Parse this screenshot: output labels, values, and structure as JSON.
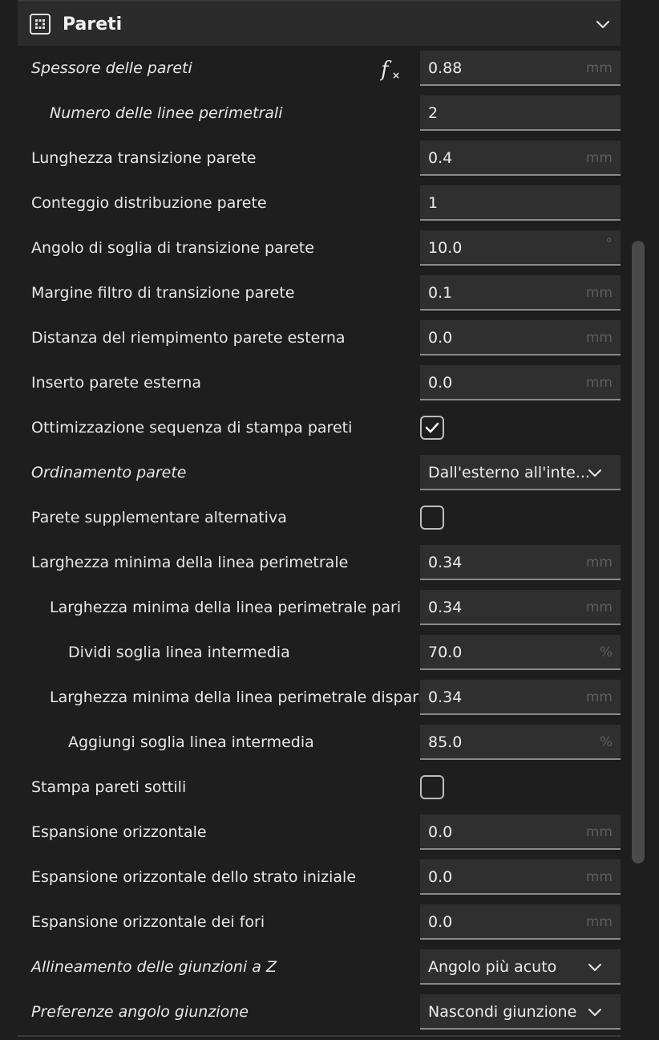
{
  "section": {
    "title": "Pareti",
    "icon": "walls-grid-icon",
    "expand_icon": "chevron-down-icon"
  },
  "rows": [
    {
      "id": "wall-thickness",
      "label": "Spessore delle pareti",
      "italic": true,
      "indent": 0,
      "type": "input",
      "value": "0.88",
      "unit": "mm",
      "formula_icon": true
    },
    {
      "id": "wall-line-count",
      "label": "Numero delle linee perimetrali",
      "italic": true,
      "indent": 1,
      "type": "input",
      "value": "2",
      "unit": ""
    },
    {
      "id": "wall-transition-length",
      "label": "Lunghezza transizione parete",
      "italic": false,
      "indent": 0,
      "type": "input",
      "value": "0.4",
      "unit": "mm"
    },
    {
      "id": "wall-distribution-count",
      "label": "Conteggio distribuzione parete",
      "italic": false,
      "indent": 0,
      "type": "input",
      "value": "1",
      "unit": ""
    },
    {
      "id": "wall-transition-angle",
      "label": "Angolo di soglia di transizione parete",
      "italic": false,
      "indent": 0,
      "type": "input",
      "value": "10.0",
      "unit": "°"
    },
    {
      "id": "wall-transition-filter",
      "label": "Margine filtro di transizione parete",
      "italic": false,
      "indent": 0,
      "type": "input",
      "value": "0.1",
      "unit": "mm"
    },
    {
      "id": "outer-wall-wipe",
      "label": "Distanza del riempimento parete esterna",
      "italic": false,
      "indent": 0,
      "type": "input",
      "value": "0.0",
      "unit": "mm"
    },
    {
      "id": "outer-wall-inset",
      "label": "Inserto parete esterna",
      "italic": false,
      "indent": 0,
      "type": "input",
      "value": "0.0",
      "unit": "mm"
    },
    {
      "id": "optimize-wall-order",
      "label": "Ottimizzazione sequenza di stampa pareti",
      "italic": false,
      "indent": 0,
      "type": "checkbox",
      "checked": true
    },
    {
      "id": "wall-ordering",
      "label": "Ordinamento parete",
      "italic": true,
      "indent": 0,
      "type": "dropdown",
      "value": "Dall'esterno all'inte..."
    },
    {
      "id": "alternate-extra-wall",
      "label": "Parete supplementare alternativa",
      "italic": false,
      "indent": 0,
      "type": "checkbox",
      "checked": false
    },
    {
      "id": "min-wall-line-width",
      "label": "Larghezza minima della linea perimetrale",
      "italic": false,
      "indent": 0,
      "type": "input",
      "value": "0.34",
      "unit": "mm"
    },
    {
      "id": "min-even-wall-line-width",
      "label": "Larghezza minima della linea perimetrale pari",
      "italic": false,
      "indent": 1,
      "type": "input",
      "value": "0.34",
      "unit": "mm"
    },
    {
      "id": "split-middle-line",
      "label": "Dividi soglia linea intermedia",
      "italic": false,
      "indent": 2,
      "type": "input",
      "value": "70.0",
      "unit": "%"
    },
    {
      "id": "min-odd-wall-line-width",
      "label": "Larghezza minima della linea perimetrale dispari",
      "italic": false,
      "indent": 1,
      "type": "input",
      "value": "0.34",
      "unit": "mm"
    },
    {
      "id": "add-middle-line",
      "label": "Aggiungi soglia linea intermedia",
      "italic": false,
      "indent": 2,
      "type": "input",
      "value": "85.0",
      "unit": "%"
    },
    {
      "id": "print-thin-walls",
      "label": "Stampa pareti sottili",
      "italic": false,
      "indent": 0,
      "type": "checkbox",
      "checked": false
    },
    {
      "id": "horizontal-expansion",
      "label": "Espansione orizzontale",
      "italic": false,
      "indent": 0,
      "type": "input",
      "value": "0.0",
      "unit": "mm"
    },
    {
      "id": "initial-layer-expansion",
      "label": "Espansione orizzontale dello strato iniziale",
      "italic": false,
      "indent": 0,
      "type": "input",
      "value": "0.0",
      "unit": "mm"
    },
    {
      "id": "hole-expansion",
      "label": "Espansione orizzontale dei fori",
      "italic": false,
      "indent": 0,
      "type": "input",
      "value": "0.0",
      "unit": "mm"
    },
    {
      "id": "z-seam-alignment",
      "label": "Allineamento delle giunzioni a Z",
      "italic": true,
      "indent": 0,
      "type": "dropdown",
      "value": "Angolo più acuto"
    },
    {
      "id": "seam-corner-pref",
      "label": "Preferenze angolo giunzione",
      "italic": true,
      "indent": 0,
      "type": "dropdown",
      "value": "Nascondi giunzione"
    }
  ]
}
